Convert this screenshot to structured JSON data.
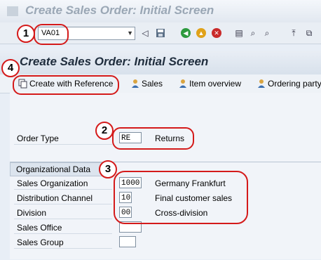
{
  "window": {
    "title": "Create Sales Order: Initial Screen"
  },
  "toolbar": {
    "command_value": "VA01"
  },
  "screen": {
    "header": "Create Sales Order: Initial Screen"
  },
  "app_toolbar": {
    "create_with_reference": "Create with Reference",
    "sales": "Sales",
    "item_overview": "Item overview",
    "ordering_party": "Ordering party"
  },
  "order_type": {
    "label": "Order Type",
    "value": "RE",
    "description": "Returns"
  },
  "org_data": {
    "title": "Organizational Data",
    "rows": [
      {
        "label": "Sales Organization",
        "value": "1000",
        "description": "Germany Frankfurt"
      },
      {
        "label": "Distribution Channel",
        "value": "10",
        "description": "Final customer sales"
      },
      {
        "label": "Division",
        "value": "00",
        "description": "Cross-division"
      },
      {
        "label": "Sales Office",
        "value": "",
        "description": ""
      },
      {
        "label": "Sales Group",
        "value": "",
        "description": ""
      }
    ]
  },
  "markers": [
    "1",
    "2",
    "3",
    "4"
  ],
  "colors": {
    "marker_red": "#d41a1a",
    "header_text": "#1f2d3d"
  },
  "icons": [
    "sap-logo-icon",
    "dropdown-arrow-icon",
    "back-arrow-icon",
    "save-icon",
    "green-back-icon",
    "exit-icon",
    "cancel-icon",
    "print-icon",
    "find-icon",
    "find-next-icon",
    "first-page-icon",
    "create-session-icon",
    "copy-icon",
    "sales-icon",
    "item-overview-icon",
    "ordering-party-icon"
  ]
}
